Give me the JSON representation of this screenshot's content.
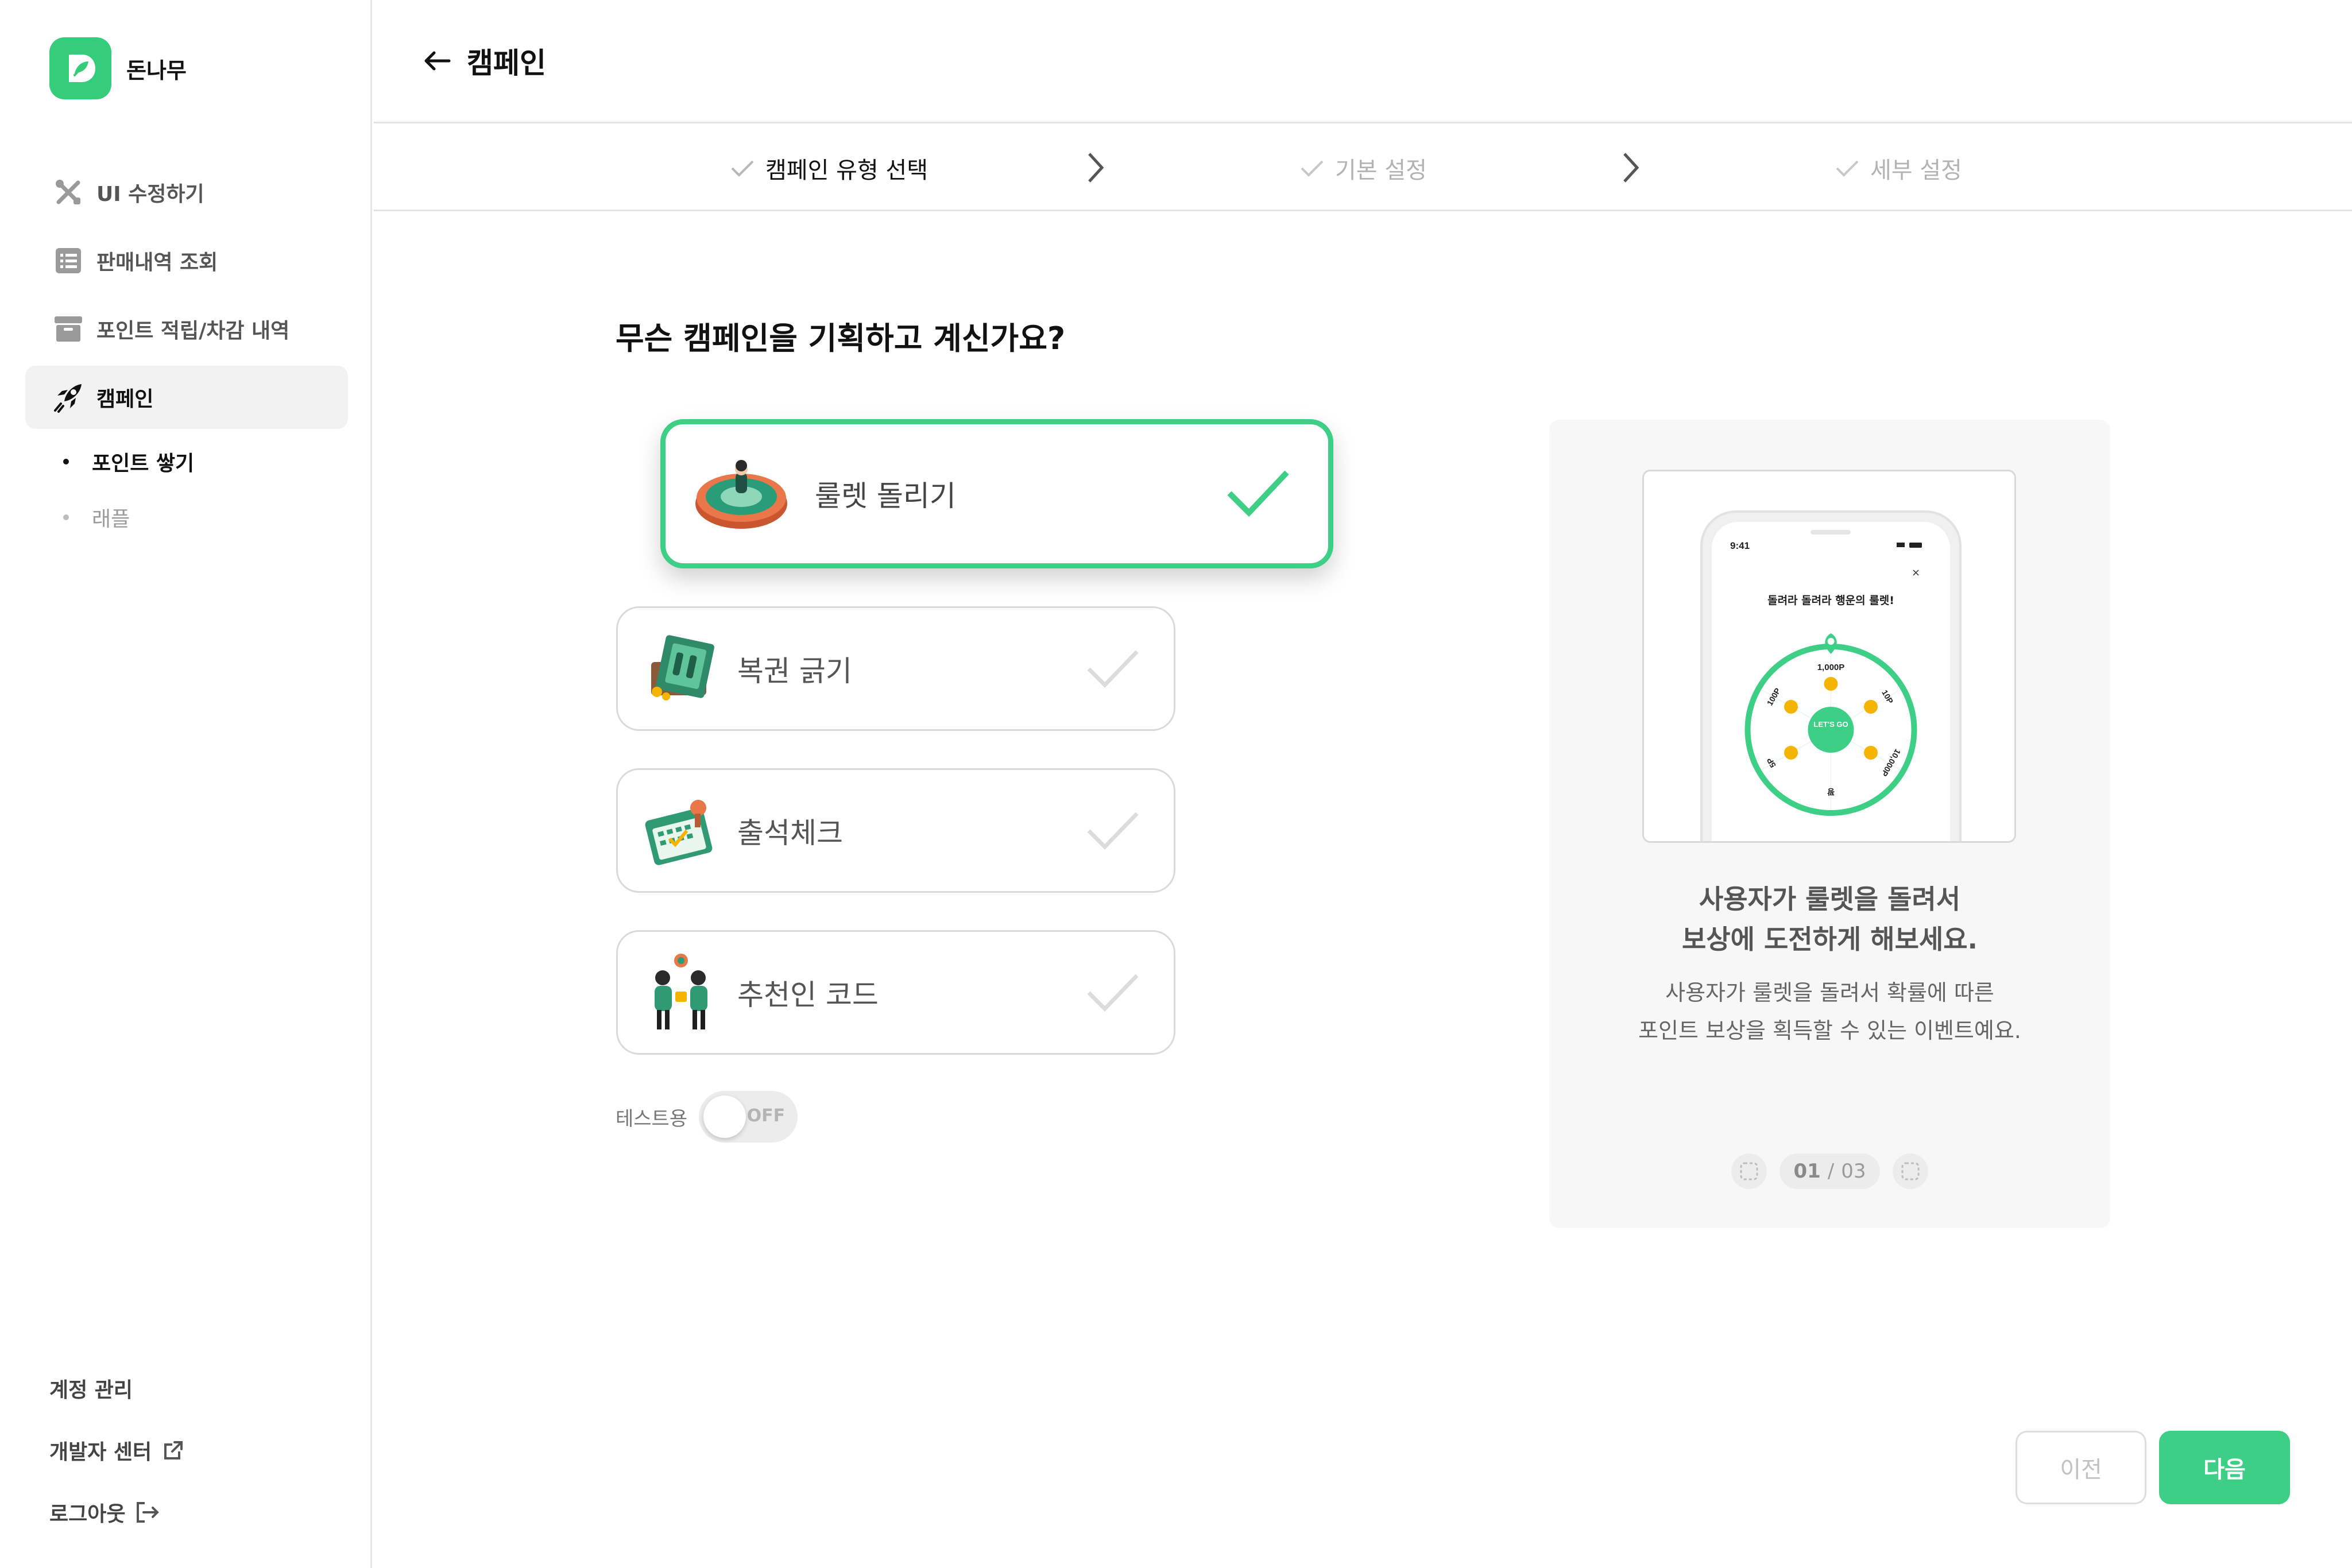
{
  "brand": {
    "name": "돈나무",
    "logo_icon": "brand-leaf-logo",
    "accent": "#35cc7b"
  },
  "sidebar": {
    "items": [
      {
        "label": "UI 수정하기",
        "icon": "tools-icon"
      },
      {
        "label": "판매내역 조회",
        "icon": "list-icon"
      },
      {
        "label": "포인트 적립/차감 내역",
        "icon": "archive-icon"
      },
      {
        "label": "캠페인",
        "icon": "rocket-icon",
        "active": true
      }
    ],
    "sub_items": [
      {
        "label": "포인트 쌓기",
        "active": true
      },
      {
        "label": "래플",
        "active": false
      }
    ],
    "footer": {
      "account": "계정 관리",
      "developer": "개발자 센터",
      "logout": "로그아웃"
    }
  },
  "header": {
    "title": "캠페인"
  },
  "steps": [
    {
      "label": "캠페인 유형 선택",
      "state": "current"
    },
    {
      "label": "기본 설정",
      "state": "pending"
    },
    {
      "label": "세부 설정",
      "state": "pending"
    }
  ],
  "main": {
    "question": "무슨 캠페인을 기획하고 계신가요?",
    "options": [
      {
        "label": "룰렛 돌리기",
        "icon": "roulette-illustration",
        "selected": true
      },
      {
        "label": "복권 긁기",
        "icon": "lottery-illustration",
        "selected": false
      },
      {
        "label": "출석체크",
        "icon": "calendar-illustration",
        "selected": false
      },
      {
        "label": "추천인 코드",
        "icon": "referral-illustration",
        "selected": false
      }
    ],
    "toggle": {
      "label": "테스트용",
      "state": "OFF"
    }
  },
  "preview": {
    "phone": {
      "time": "9:41",
      "title": "돌려라 돌려라 행운의 룰렛!",
      "center_label": "LET'S GO",
      "segments": [
        "1,000P",
        "10P",
        "10,000P",
        "꽝",
        "5P",
        "100P"
      ]
    },
    "headline_line1": "사용자가 룰렛을 돌려서",
    "headline_line2": "보상에 도전하게 해보세요.",
    "desc_line1": "사용자가 룰렛을 돌려서 확률에 따른",
    "desc_line2": "포인트 보상을 획득할 수 있는 이벤트예요.",
    "pager": {
      "current": "01",
      "separator": "/",
      "total": "03"
    }
  },
  "buttons": {
    "prev": "이전",
    "next": "다음"
  },
  "colors": {
    "accent": "#3dcf85",
    "muted": "#c2c2c2"
  }
}
